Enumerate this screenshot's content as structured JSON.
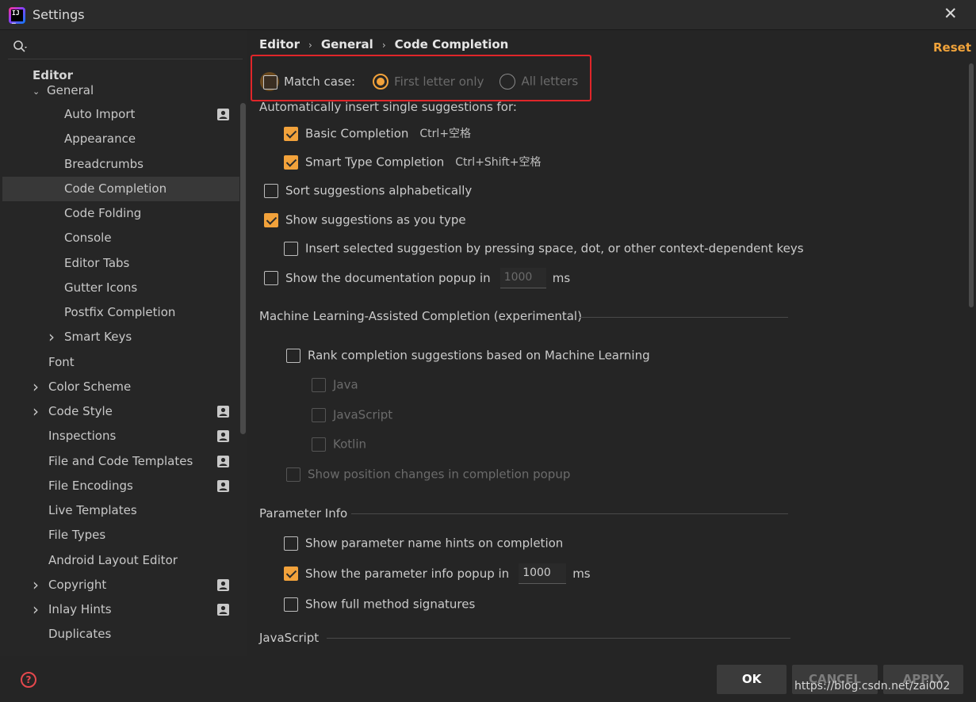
{
  "window": {
    "title": "Settings",
    "close_glyph": "✕"
  },
  "sidebar": {
    "header": "Editor",
    "general": "General",
    "items": [
      {
        "label": "Auto Import",
        "level": 2,
        "badge": true,
        "chevron": false,
        "selected": false
      },
      {
        "label": "Appearance",
        "level": 2,
        "badge": false,
        "chevron": false,
        "selected": false
      },
      {
        "label": "Breadcrumbs",
        "level": 2,
        "badge": false,
        "chevron": false,
        "selected": false
      },
      {
        "label": "Code Completion",
        "level": 2,
        "badge": false,
        "chevron": false,
        "selected": true
      },
      {
        "label": "Code Folding",
        "level": 2,
        "badge": false,
        "chevron": false,
        "selected": false
      },
      {
        "label": "Console",
        "level": 2,
        "badge": false,
        "chevron": false,
        "selected": false
      },
      {
        "label": "Editor Tabs",
        "level": 2,
        "badge": false,
        "chevron": false,
        "selected": false
      },
      {
        "label": "Gutter Icons",
        "level": 2,
        "badge": false,
        "chevron": false,
        "selected": false
      },
      {
        "label": "Postfix Completion",
        "level": 2,
        "badge": false,
        "chevron": false,
        "selected": false
      },
      {
        "label": "Smart Keys",
        "level": 2,
        "badge": false,
        "chevron": true,
        "selected": false
      },
      {
        "label": "Font",
        "level": 1,
        "badge": false,
        "chevron": false,
        "selected": false
      },
      {
        "label": "Color Scheme",
        "level": 1,
        "badge": false,
        "chevron": true,
        "selected": false
      },
      {
        "label": "Code Style",
        "level": 1,
        "badge": true,
        "chevron": true,
        "selected": false
      },
      {
        "label": "Inspections",
        "level": 1,
        "badge": true,
        "chevron": false,
        "selected": false
      },
      {
        "label": "File and Code Templates",
        "level": 1,
        "badge": true,
        "chevron": false,
        "selected": false
      },
      {
        "label": "File Encodings",
        "level": 1,
        "badge": true,
        "chevron": false,
        "selected": false
      },
      {
        "label": "Live Templates",
        "level": 1,
        "badge": false,
        "chevron": false,
        "selected": false
      },
      {
        "label": "File Types",
        "level": 1,
        "badge": false,
        "chevron": false,
        "selected": false
      },
      {
        "label": "Android Layout Editor",
        "level": 1,
        "badge": false,
        "chevron": false,
        "selected": false
      },
      {
        "label": "Copyright",
        "level": 1,
        "badge": true,
        "chevron": true,
        "selected": false
      },
      {
        "label": "Inlay Hints",
        "level": 1,
        "badge": true,
        "chevron": true,
        "selected": false
      },
      {
        "label": "Duplicates",
        "level": 1,
        "badge": false,
        "chevron": false,
        "selected": false
      }
    ]
  },
  "breadcrumb": {
    "part1": "Editor",
    "part2": "General",
    "part3": "Code Completion",
    "sep": "›"
  },
  "reset_label": "Reset",
  "match_case": {
    "label": "Match case:",
    "option_first": "First letter only",
    "option_all": "All letters",
    "selected": "First letter only"
  },
  "auto_insert_label": "Automatically insert single suggestions for:",
  "basic_completion": {
    "label": "Basic Completion",
    "shortcut": "Ctrl+空格",
    "checked": true
  },
  "smart_completion": {
    "label": "Smart Type Completion",
    "shortcut": "Ctrl+Shift+空格",
    "checked": true
  },
  "sort_alpha": {
    "label": "Sort suggestions alphabetically",
    "checked": false
  },
  "show_as_type": {
    "label": "Show suggestions as you type",
    "checked": true
  },
  "insert_selected": {
    "label": "Insert selected suggestion by pressing space, dot, or other context-dependent keys",
    "checked": false
  },
  "doc_popup": {
    "label": "Show the documentation popup in",
    "value": "1000",
    "unit": "ms",
    "checked": false
  },
  "ml_section": {
    "title": "Machine Learning-Assisted Completion (experimental)",
    "rank_label": "Rank completion suggestions based on Machine Learning",
    "java": "Java",
    "javascript": "JavaScript",
    "kotlin": "Kotlin",
    "position_label": "Show position changes in completion popup"
  },
  "param_section": {
    "title": "Parameter Info",
    "name_hints": {
      "label": "Show parameter name hints on completion",
      "checked": false
    },
    "info_popup": {
      "label": "Show the parameter info popup in",
      "value": "1000",
      "unit": "ms",
      "checked": true
    },
    "full_sigs": {
      "label": "Show full method signatures",
      "checked": false
    }
  },
  "js_section": {
    "title": "JavaScript"
  },
  "buttons": {
    "ok": "OK",
    "cancel": "CANCEL",
    "apply": "APPLY"
  },
  "watermark": "https://blog.csdn.net/zai002",
  "colors": {
    "accent": "#f2a23b",
    "highlight": "#e0262a",
    "background": "#252525"
  },
  "help_glyph": "?"
}
